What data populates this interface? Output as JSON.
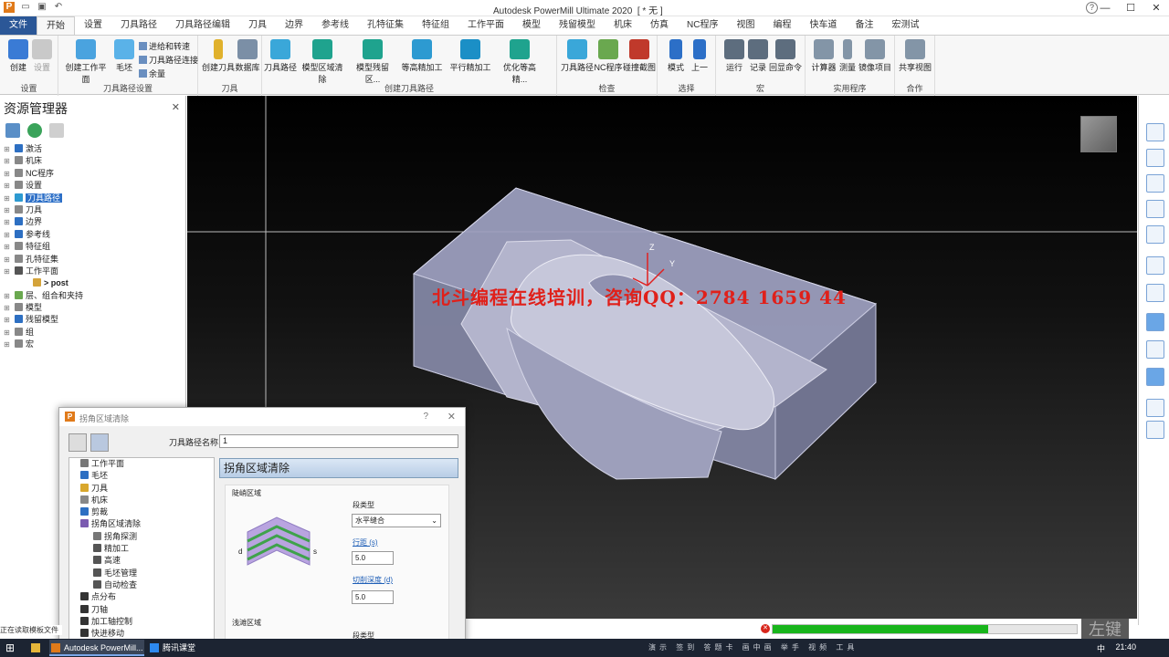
{
  "window": {
    "title": "Autodesk PowerMill Ultimate 2020",
    "doc_indicator": "[ * 无 ]"
  },
  "ribbon": {
    "tabs": [
      "文件",
      "开始",
      "设置",
      "刀具路径",
      "刀具路径编辑",
      "刀具",
      "边界",
      "参考线",
      "孔特征集",
      "特征组",
      "工作平面",
      "模型",
      "残留模型",
      "机床",
      "仿真",
      "NC程序",
      "视图",
      "编程",
      "快车道",
      "备注",
      "宏测试"
    ],
    "active_tab": "开始",
    "groups": [
      {
        "name": "设置",
        "buttons": [
          "创建",
          "设置"
        ]
      },
      {
        "name": "刀具路径设置",
        "buttons": [
          "创建工作平面",
          "毛坯"
        ],
        "small": [
          "进给和转速",
          "刀具路径连接",
          "余量"
        ]
      },
      {
        "name": "刀具",
        "buttons": [
          "创建刀具",
          "数据库"
        ]
      },
      {
        "name": "创建刀具路径",
        "buttons": [
          "刀具路径",
          "模型区域清除",
          "模型残留区...",
          "等高精加工",
          "平行精加工",
          "优化等高精..."
        ]
      },
      {
        "name": "检查",
        "buttons": [
          "刀具路径",
          "NC程序",
          "碰撞截图"
        ]
      },
      {
        "name": "选择",
        "buttons": [
          "模式",
          "上一"
        ]
      },
      {
        "name": "宏",
        "buttons": [
          "运行",
          "记录",
          "回显命令"
        ]
      },
      {
        "name": "实用程序",
        "buttons": [
          "计算器",
          "测量",
          "镜像项目"
        ]
      },
      {
        "name": "合作",
        "buttons": [
          "共享视图"
        ]
      }
    ]
  },
  "explorer": {
    "title": "资源管理器",
    "items": [
      {
        "label": "激活",
        "color": "#2d6fc2"
      },
      {
        "label": "机床",
        "color": "#888888"
      },
      {
        "label": "NC程序",
        "color": "#888888"
      },
      {
        "label": "设置",
        "color": "#888888"
      },
      {
        "label": "刀具路径",
        "color": "#2d9ad1",
        "selected": true
      },
      {
        "label": "刀具",
        "color": "#888888"
      },
      {
        "label": "边界",
        "color": "#2d6fc2"
      },
      {
        "label": "参考线",
        "color": "#2d6fc2"
      },
      {
        "label": "特征组",
        "color": "#888888"
      },
      {
        "label": "孔特征集",
        "color": "#888888"
      },
      {
        "label": "工作平面",
        "color": "#555555"
      },
      {
        "label": "> post",
        "color": "#d4a33a",
        "indent": true
      },
      {
        "label": "层、组合和夹持",
        "color": "#6aa84f"
      },
      {
        "label": "模型",
        "color": "#888888"
      },
      {
        "label": "残留模型",
        "color": "#2d6fc2"
      },
      {
        "label": "组",
        "color": "#888888"
      },
      {
        "label": "宏",
        "color": "#888888"
      }
    ]
  },
  "viewport": {
    "watermark": "北斗编程在线培训，咨询QQ：2784 1659 44",
    "axis_z": "Z",
    "axis_y": "Y"
  },
  "dialog": {
    "title": "拐角区域清除",
    "help": "?",
    "toolpath_name_label": "刀具路径名称",
    "toolpath_name_value": "1",
    "header": "拐角区域清除",
    "tree": [
      {
        "label": "工作平面",
        "color": "#777777",
        "level": 1
      },
      {
        "label": "毛坯",
        "color": "#2d6fc2",
        "level": 1
      },
      {
        "label": "刀具",
        "color": "#d9a72c",
        "level": 1
      },
      {
        "label": "机床",
        "color": "#888888",
        "level": 1
      },
      {
        "label": "剪裁",
        "color": "#2d6fc2",
        "level": 1
      },
      {
        "label": "拐角区域清除",
        "color": "#7b5bb0",
        "level": 1
      },
      {
        "label": "拐角探测",
        "color": "#777777",
        "level": 2
      },
      {
        "label": "精加工",
        "color": "#555555",
        "level": 2
      },
      {
        "label": "高速",
        "color": "#555555",
        "level": 2
      },
      {
        "label": "毛坯管理",
        "color": "#555555",
        "level": 2
      },
      {
        "label": "自动检查",
        "color": "#555555",
        "level": 2
      },
      {
        "label": "点分布",
        "color": "#333333",
        "level": 1
      },
      {
        "label": "刀轴",
        "color": "#333333",
        "level": 1
      },
      {
        "label": "加工轴控制",
        "color": "#333333",
        "level": 1
      },
      {
        "label": "快进移动",
        "color": "#333333",
        "level": 1
      }
    ],
    "steep_region_label": "陡峭区域",
    "segment_type_label": "段类型",
    "segment_type_value": "水平缝合",
    "stepover_label": "行距 (s)",
    "stepover_value": "5.0",
    "stepdown_label": "切削深度 (d)",
    "stepdown_value": "5.0",
    "shallow_region_label": "浅滩区域",
    "segment_type_label2": "段类型"
  },
  "status": {
    "text": "正在读取模板文件",
    "progress_percent": 71
  },
  "taskbar": {
    "items": [
      "Autodesk PowerMill...",
      "腾讯课堂"
    ],
    "tray_text": "演示 签到 答题卡 画中画 举手 视频 工具",
    "lang": "中",
    "clock": "21:40"
  },
  "overlay_key": "左键",
  "colors": {
    "ribbon_file_tab": "#2b5797",
    "selection": "#2c6fc7",
    "progress": "#18b51b",
    "watermark": "#e0201a"
  }
}
